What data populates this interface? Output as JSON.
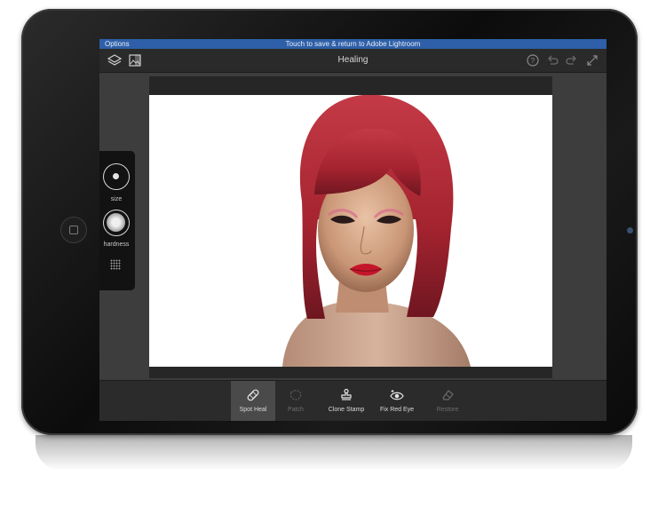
{
  "status_bar": {
    "left": "Options",
    "center": "Touch to save & return to Adobe Lightroom"
  },
  "toolbar": {
    "title": "Healing",
    "left_icons": [
      "layers-icon",
      "photo-compare-icon"
    ],
    "right_icons": [
      "help-icon",
      "undo-icon",
      "redo-icon",
      "fullscreen-icon"
    ]
  },
  "side_panel": {
    "size_label": "size",
    "hardness_label": "hardness"
  },
  "tools": [
    {
      "label": "Spot Heal",
      "icon": "bandage-icon",
      "active": true,
      "enabled": true
    },
    {
      "label": "Patch",
      "icon": "patch-icon",
      "active": false,
      "enabled": false
    },
    {
      "label": "Clone Stamp",
      "icon": "stamp-icon",
      "active": false,
      "enabled": true
    },
    {
      "label": "Fix Red Eye",
      "icon": "eye-icon",
      "active": false,
      "enabled": true
    },
    {
      "label": "Restore",
      "icon": "eraser-icon",
      "active": false,
      "enabled": false
    }
  ],
  "colors": {
    "status_bar": "#2e5fa8",
    "hair": "#a3232f",
    "lips": "#c4162b"
  }
}
